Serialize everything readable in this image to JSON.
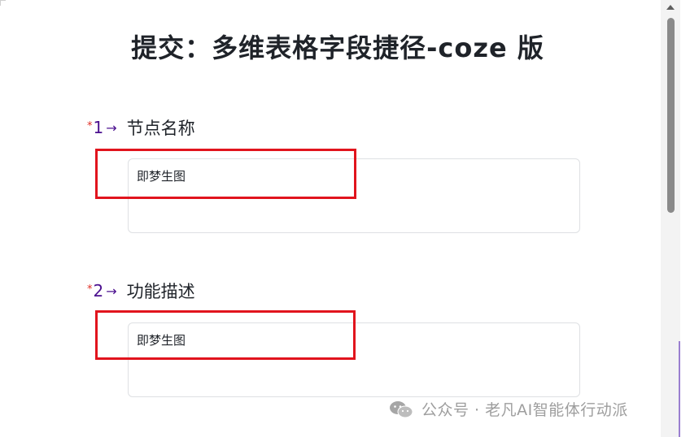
{
  "form": {
    "title": "提交：多维表格字段捷径-coze 版",
    "questions": [
      {
        "required_mark": "*",
        "number": "1",
        "arrow": "→",
        "label": "节点名称",
        "value": "即梦生图"
      },
      {
        "required_mark": "*",
        "number": "2",
        "arrow": "→",
        "label": "功能描述",
        "value": "即梦生图"
      }
    ]
  },
  "watermark": {
    "text": "公众号 · 老凡AI智能体行动派",
    "icon": "wechat-icon"
  },
  "colors": {
    "highlight": "#e1141d",
    "question_number": "#4b0f8f",
    "required": "#e02e24"
  }
}
